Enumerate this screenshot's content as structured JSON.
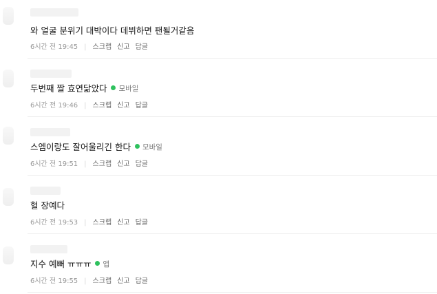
{
  "comments": [
    {
      "text": "와 얼굴 분위기 대박이다 데뷔하면 팬될거같음",
      "badge_label": "",
      "time_ago": "6시간 전",
      "clock": "19:45",
      "scrap_label": "스크랩",
      "report_label": "신고",
      "reply_label": "답글"
    },
    {
      "text": "두번째 짤 효연닮았다",
      "badge_label": "모바일",
      "time_ago": "6시간 전",
      "clock": "19:46",
      "scrap_label": "스크랩",
      "report_label": "신고",
      "reply_label": "답글"
    },
    {
      "text": "스엠이랑도 잘어울리긴 한다",
      "badge_label": "모바일",
      "time_ago": "6시간 전",
      "clock": "19:51",
      "scrap_label": "스크랩",
      "report_label": "신고",
      "reply_label": "답글"
    },
    {
      "text": "헐 장예다",
      "badge_label": "",
      "time_ago": "6시간 전",
      "clock": "19:53",
      "scrap_label": "스크랩",
      "report_label": "신고",
      "reply_label": "답글"
    },
    {
      "text": "지수 예뻐 ㅠㅠㅠ",
      "badge_label": "앱",
      "time_ago": "6시간 전",
      "clock": "19:55",
      "scrap_label": "스크랩",
      "report_label": "신고",
      "reply_label": "답글"
    }
  ],
  "colors": {
    "mobile_dot": "#2fc15e",
    "divider": "#ededed",
    "meta_text": "#888888"
  }
}
